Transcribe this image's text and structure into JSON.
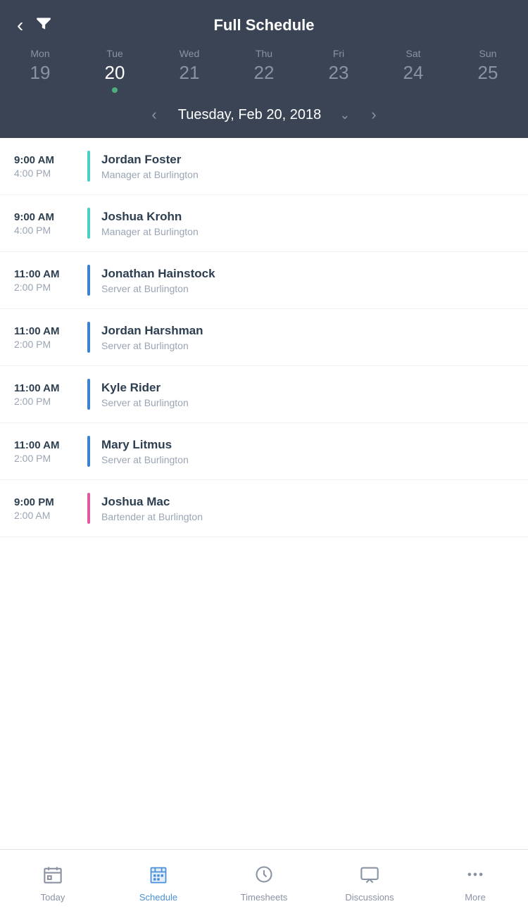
{
  "header": {
    "title": "Full Schedule",
    "back_label": "‹",
    "filter_label": "▼"
  },
  "calendar": {
    "days": [
      {
        "name": "Mon",
        "num": "19",
        "active": false,
        "dot": false
      },
      {
        "name": "Tue",
        "num": "20",
        "active": true,
        "dot": true
      },
      {
        "name": "Wed",
        "num": "21",
        "active": false,
        "dot": false
      },
      {
        "name": "Thu",
        "num": "22",
        "active": false,
        "dot": false
      },
      {
        "name": "Fri",
        "num": "23",
        "active": false,
        "dot": false
      },
      {
        "name": "Sat",
        "num": "24",
        "active": false,
        "dot": false
      },
      {
        "name": "Sun",
        "num": "25",
        "active": false,
        "dot": false
      }
    ]
  },
  "date_nav": {
    "label": "Tuesday, Feb 20, 2018"
  },
  "schedule": {
    "items": [
      {
        "start": "9:00 AM",
        "end": "4:00 PM",
        "name": "Jordan Foster",
        "role": "Manager at Burlington",
        "color": "#4ecdc4"
      },
      {
        "start": "9:00 AM",
        "end": "4:00 PM",
        "name": "Joshua Krohn",
        "role": "Manager at Burlington",
        "color": "#4ecdc4"
      },
      {
        "start": "11:00 AM",
        "end": "2:00 PM",
        "name": "Jonathan Hainstock",
        "role": "Server at Burlington",
        "color": "#3b82d0"
      },
      {
        "start": "11:00 AM",
        "end": "2:00 PM",
        "name": "Jordan Harshman",
        "role": "Server at Burlington",
        "color": "#3b82d0"
      },
      {
        "start": "11:00 AM",
        "end": "2:00 PM",
        "name": "Kyle Rider",
        "role": "Server at Burlington",
        "color": "#3b82d0"
      },
      {
        "start": "11:00 AM",
        "end": "2:00 PM",
        "name": "Mary Litmus",
        "role": "Server at Burlington",
        "color": "#3b82d0"
      },
      {
        "start": "9:00 PM",
        "end": "2:00 AM",
        "name": "Joshua Mac",
        "role": "Bartender at Burlington",
        "color": "#e05aa0"
      }
    ]
  },
  "tabs": [
    {
      "id": "today",
      "label": "Today",
      "active": false
    },
    {
      "id": "schedule",
      "label": "Schedule",
      "active": true
    },
    {
      "id": "timesheets",
      "label": "Timesheets",
      "active": false
    },
    {
      "id": "discussions",
      "label": "Discussions",
      "active": false
    },
    {
      "id": "more",
      "label": "More",
      "active": false
    }
  ],
  "colors": {
    "header_bg": "#3a4454",
    "active_day_dot": "#4caf7d",
    "teal": "#4ecdc4",
    "blue": "#3b82d0",
    "pink": "#e05aa0",
    "tab_active": "#4a90d9"
  }
}
